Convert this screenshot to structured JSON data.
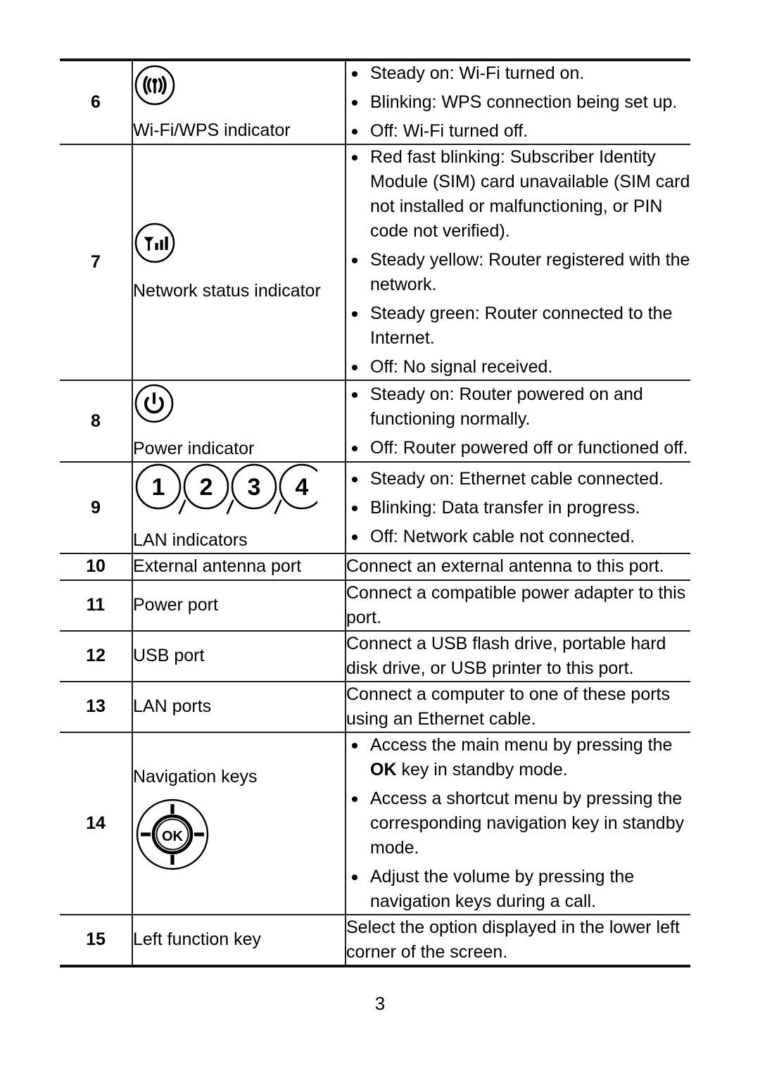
{
  "page": {
    "number": "3"
  },
  "table": {
    "rows": [
      {
        "num": "6",
        "icon": "wifi-wps-indicator-icon",
        "item_label": "Wi-Fi/WPS indicator",
        "desc_type": "bullets",
        "bullets": [
          "Steady on: Wi-Fi turned on.",
          "Blinking: WPS connection being set up.",
          "Off: Wi-Fi turned off."
        ]
      },
      {
        "num": "7",
        "icon": "network-status-indicator-icon",
        "item_label": "Network status indicator",
        "desc_type": "bullets",
        "bullets": [
          "Red fast blinking: Subscriber Identity Module (SIM) card unavailable (SIM card not installed or malfunctioning, or PIN code not verified).",
          "Steady yellow: Router registered with the network.",
          "Steady green: Router connected to the Internet.",
          "Off: No signal received."
        ]
      },
      {
        "num": "8",
        "icon": "power-indicator-icon",
        "item_label": "Power indicator",
        "desc_type": "bullets",
        "bullets": [
          "Steady on: Router powered on and functioning normally.",
          "Off: Router powered off or functioned off."
        ]
      },
      {
        "num": "9",
        "icon": "lan-indicators-icon",
        "lan_numbers": [
          "1",
          "2",
          "3",
          "4"
        ],
        "item_label": "LAN indicators",
        "desc_type": "bullets",
        "bullets": [
          "Steady on: Ethernet cable connected.",
          "Blinking: Data transfer in progress.",
          "Off: Network cable not connected."
        ]
      },
      {
        "num": "10",
        "icon": null,
        "item_label": "External antenna port",
        "desc_type": "plain",
        "text": "Connect an external antenna to this port."
      },
      {
        "num": "11",
        "icon": null,
        "item_label": "Power port",
        "desc_type": "plain",
        "text": "Connect a compatible power adapter to this port."
      },
      {
        "num": "12",
        "icon": null,
        "item_label": "USB port",
        "desc_type": "plain",
        "text": "Connect a USB flash drive, portable hard disk drive, or USB printer to this port."
      },
      {
        "num": "13",
        "icon": null,
        "item_label": "LAN ports",
        "desc_type": "plain",
        "text": "Connect a computer to one of these ports using an Ethernet cable."
      },
      {
        "num": "14",
        "icon": "navigation-keys-icon",
        "nav_center_label": "OK",
        "item_label": "Navigation keys",
        "desc_type": "bullets-rich",
        "bullets_rich": [
          {
            "before": "Access the main menu by pressing the ",
            "bold": "OK",
            "after": " key in standby mode."
          },
          {
            "before": "Access a shortcut menu by pressing the corresponding navigation key in standby mode.",
            "bold": "",
            "after": ""
          },
          {
            "before": "Adjust the volume by pressing the navigation keys during a call.",
            "bold": "",
            "after": ""
          }
        ]
      },
      {
        "num": "15",
        "icon": null,
        "item_label": "Left function key",
        "desc_type": "plain",
        "text": "Select the option displayed in the lower left corner of the screen."
      }
    ]
  }
}
